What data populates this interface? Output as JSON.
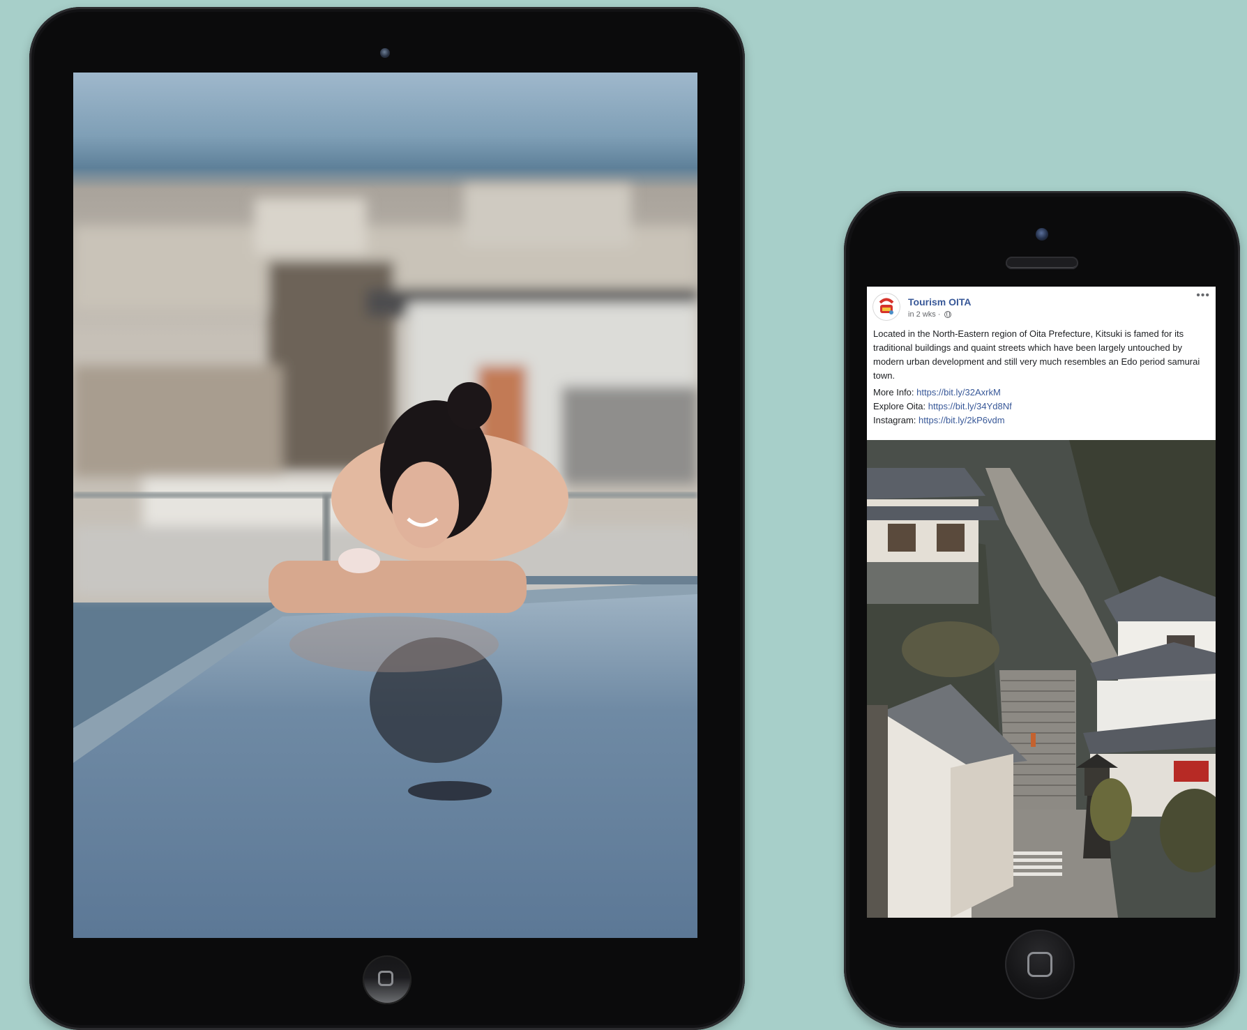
{
  "post": {
    "page_name": "Tourism OITA",
    "meta": "in 2 wks ·",
    "more": "•••",
    "text": "Located in the North-Eastern region of Oita Prefecture, Kitsuki is famed for its traditional buildings and quaint streets which have been largely untouched by modern urban development and still very much resembles an Edo period samurai town.",
    "links": [
      {
        "label": "More Info: ",
        "url": "https://bit.ly/32AxrkM"
      },
      {
        "label": "Explore Oita: ",
        "url": "https://bit.ly/34Yd8Nf"
      },
      {
        "label": "Instagram: ",
        "url": "https://bit.ly/2kP6vdm"
      }
    ]
  },
  "colors": {
    "background": "#a7cfc9",
    "device_body": "#0b0b0c",
    "link": "#385898"
  }
}
